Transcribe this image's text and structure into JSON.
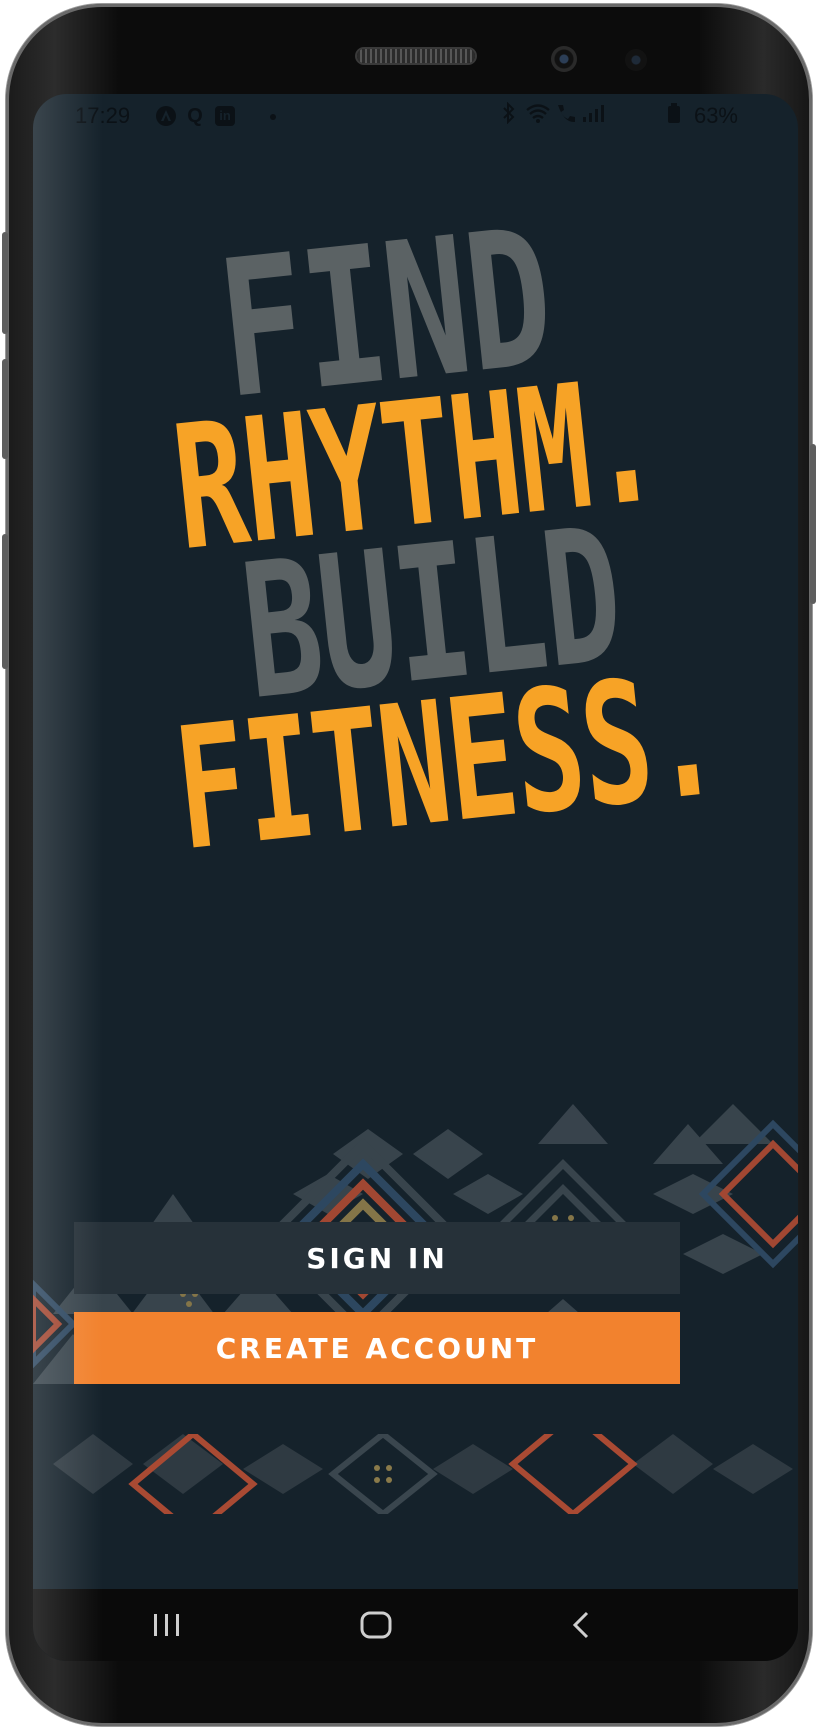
{
  "status_bar": {
    "time": "17:29",
    "left_icons": [
      "app-a-icon",
      "q-icon",
      "linkedin-icon"
    ],
    "linkedin_label": "in",
    "q_label": "Q",
    "right_icons": [
      "bluetooth-icon",
      "wifi-icon",
      "wifi-call-icon",
      "signal-icon",
      "battery-icon"
    ],
    "battery": "63%"
  },
  "headline": {
    "line1": "FIND",
    "line2": "RHYTHM.",
    "line3": "BUILD",
    "line4": "FITNESS."
  },
  "colors": {
    "background": "#15222b",
    "accent_yellow": "#f7a326",
    "gray_text": "#5b6264",
    "button_dark": "#263139",
    "button_orange": "#f2822e"
  },
  "buttons": {
    "sign_in": "SIGN IN",
    "create_account": "CREATE ACCOUNT"
  },
  "nav_bar": {
    "icons": [
      "recent-apps-icon",
      "home-icon",
      "back-icon"
    ]
  }
}
